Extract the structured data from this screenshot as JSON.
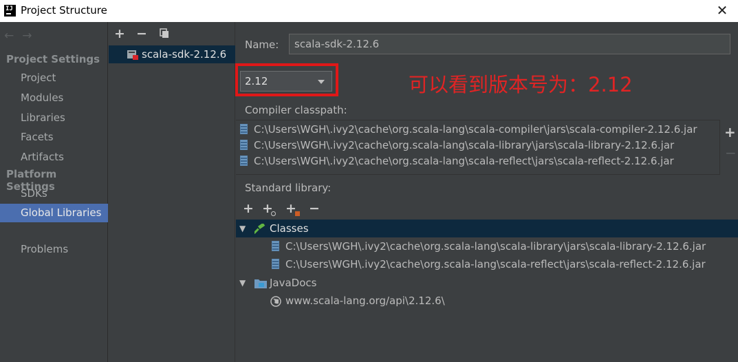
{
  "window": {
    "title": "Project Structure",
    "app_icon_text": "IJ"
  },
  "nav": {
    "project_settings_header": "Project Settings",
    "project_settings_items": [
      "Project",
      "Modules",
      "Libraries",
      "Facets",
      "Artifacts"
    ],
    "platform_settings_header": "Platform Settings",
    "platform_settings_items": [
      "SDKs",
      "Global Libraries"
    ],
    "selected_item": "Global Libraries",
    "problems": "Problems"
  },
  "libraries": {
    "items": [
      "scala-sdk-2.12.6"
    ],
    "selected": "scala-sdk-2.12.6"
  },
  "details": {
    "name_label": "Name:",
    "name_value": "scala-sdk-2.12.6",
    "version_value": "2.12",
    "annotation": "可以看到版本号为：2.12",
    "compiler_classpath_label": "Compiler classpath:",
    "compiler_classpath": [
      "C:\\Users\\WGH\\.ivy2\\cache\\org.scala-lang\\scala-compiler\\jars\\scala-compiler-2.12.6.jar",
      "C:\\Users\\WGH\\.ivy2\\cache\\org.scala-lang\\scala-library\\jars\\scala-library-2.12.6.jar",
      "C:\\Users\\WGH\\.ivy2\\cache\\org.scala-lang\\scala-reflect\\jars\\scala-reflect-2.12.6.jar"
    ],
    "standard_library_label": "Standard library:",
    "tree": {
      "classes_label": "Classes",
      "classes": [
        "C:\\Users\\WGH\\.ivy2\\cache\\org.scala-lang\\scala-library\\jars\\scala-library-2.12.6.jar",
        "C:\\Users\\WGH\\.ivy2\\cache\\org.scala-lang\\scala-reflect\\jars\\scala-reflect-2.12.6.jar"
      ],
      "javadocs_label": "JavaDocs",
      "javadocs": [
        "www.scala-lang.org/api\\2.12.6\\"
      ]
    }
  },
  "colors": {
    "annotation": "#e02424",
    "highlight_box": "#e01818",
    "selection": "#4b6eaf",
    "tree_selection": "#0d293e"
  }
}
